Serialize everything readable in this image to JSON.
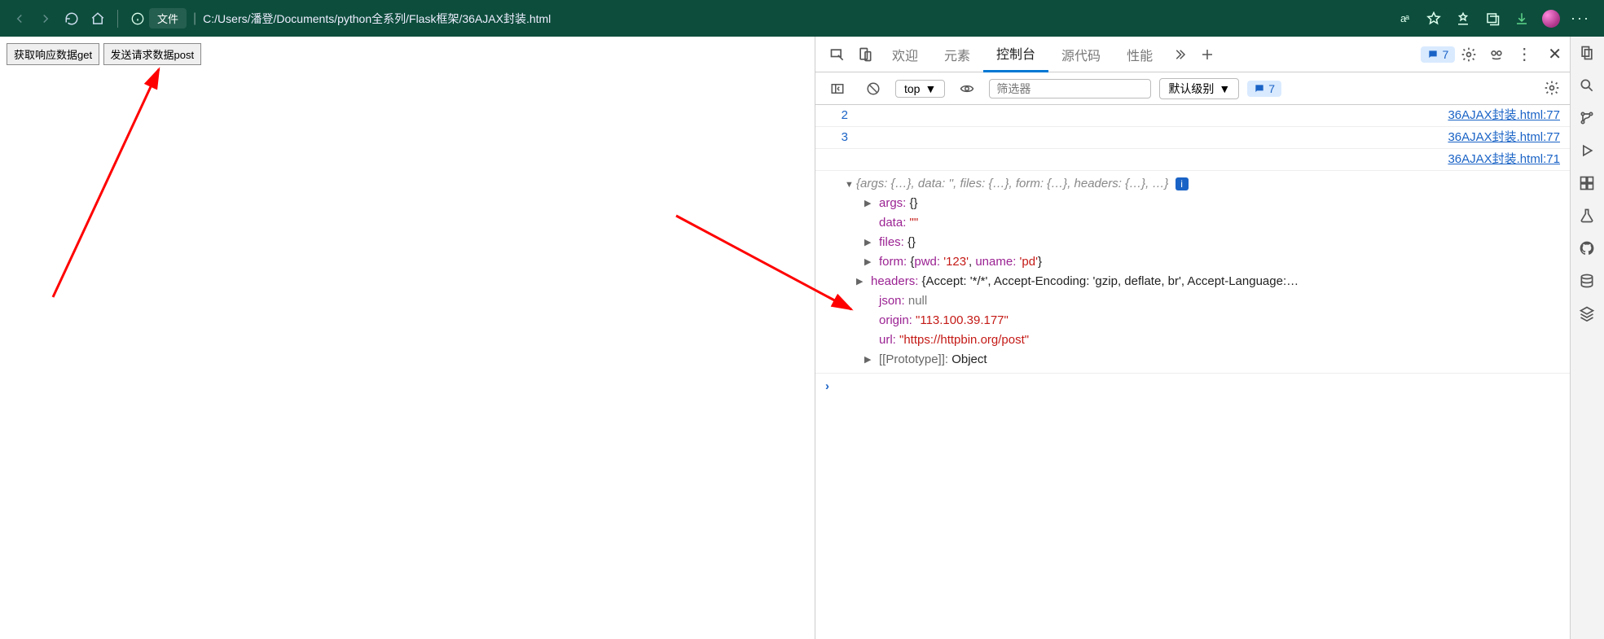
{
  "browser": {
    "file_chip_label": "文件",
    "url": "C:/Users/潘登/Documents/python全系列/Flask框架/36AJAX封装.html"
  },
  "page": {
    "button_get": "获取响应数据get",
    "button_post": "发送请求数据post"
  },
  "devtools": {
    "tabs": {
      "welcome": "欢迎",
      "elements": "元素",
      "console": "控制台",
      "sources": "源代码",
      "performance": "性能"
    },
    "issue_count": "7"
  },
  "console_toolbar": {
    "context": "top",
    "filter_placeholder": "筛选器",
    "level": "默认级别",
    "issue_count": "7"
  },
  "console_rows": [
    {
      "n": "2",
      "link": "36AJAX封装.html:77"
    },
    {
      "n": "3",
      "link": "36AJAX封装.html:77"
    },
    {
      "n": "",
      "link": "36AJAX封装.html:71"
    }
  ],
  "object_summary": "{args: {…}, data: '', files: {…}, form: {…}, headers: {…}, …}",
  "object": {
    "args_label": "args:",
    "args_value": "{}",
    "data_label": "data:",
    "data_value": "\"\"",
    "files_label": "files:",
    "files_value": "{}",
    "form_label": "form:",
    "form_inner_pwd_k": "pwd:",
    "form_inner_pwd_v": "'123'",
    "form_inner_uname_k": "uname:",
    "form_inner_uname_v": "'pd'",
    "headers_label": "headers:",
    "headers_inner": "{Accept: '*/*', Accept-Encoding: 'gzip, deflate, br', Accept-Language:…",
    "json_label": "json:",
    "json_value": "null",
    "origin_label": "origin:",
    "origin_value": "\"113.100.39.177\"",
    "url_label": "url:",
    "url_value": "\"https://httpbin.org/post\"",
    "proto_label": "[[Prototype]]:",
    "proto_value": "Object"
  }
}
